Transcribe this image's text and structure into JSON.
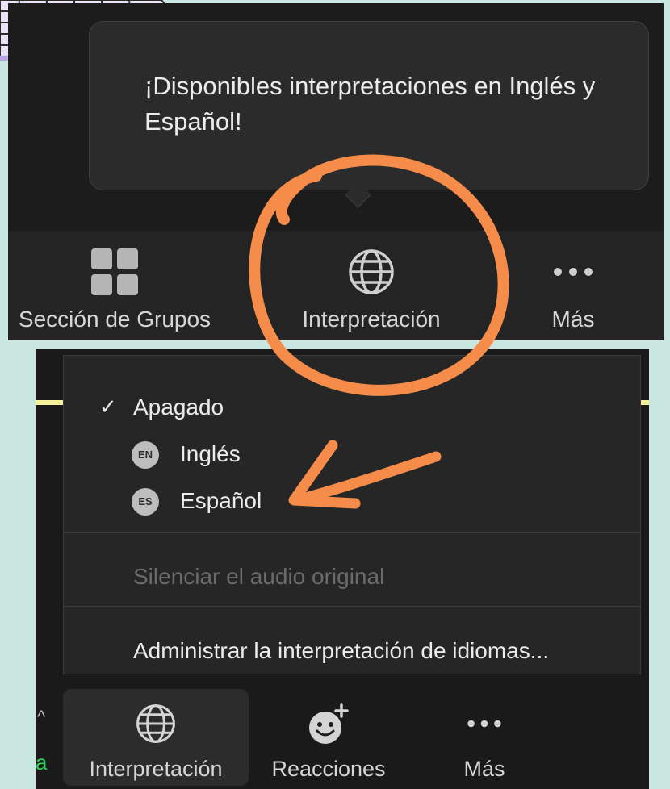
{
  "tooltip": {
    "text": "¡Disponibles interpretaciones en Inglés y Español!"
  },
  "toolbar_top": [
    {
      "label": "Sección de Grupos",
      "icon": "grid-icon"
    },
    {
      "label": "Interpretación",
      "icon": "globe-icon"
    },
    {
      "label": "Más",
      "icon": "more-icon"
    }
  ],
  "menu": {
    "items": [
      {
        "label": "Apagado",
        "checked": true
      },
      {
        "label": "Inglés",
        "badge": "EN"
      },
      {
        "label": "Español",
        "badge": "ES"
      }
    ],
    "mute_original": "Silenciar el audio original",
    "manage": "Administrar la interpretación de idiomas..."
  },
  "toolbar_bottom": {
    "left_fragment": "a",
    "buttons": [
      {
        "label": "Interpretación",
        "icon": "globe-icon",
        "active": true
      },
      {
        "label": "Reacciones",
        "icon": "smiley-add-icon"
      },
      {
        "label": "Más",
        "icon": "more-icon"
      }
    ]
  },
  "colors": {
    "annotation": "#f58c4a",
    "background": "#c9e6e1"
  }
}
